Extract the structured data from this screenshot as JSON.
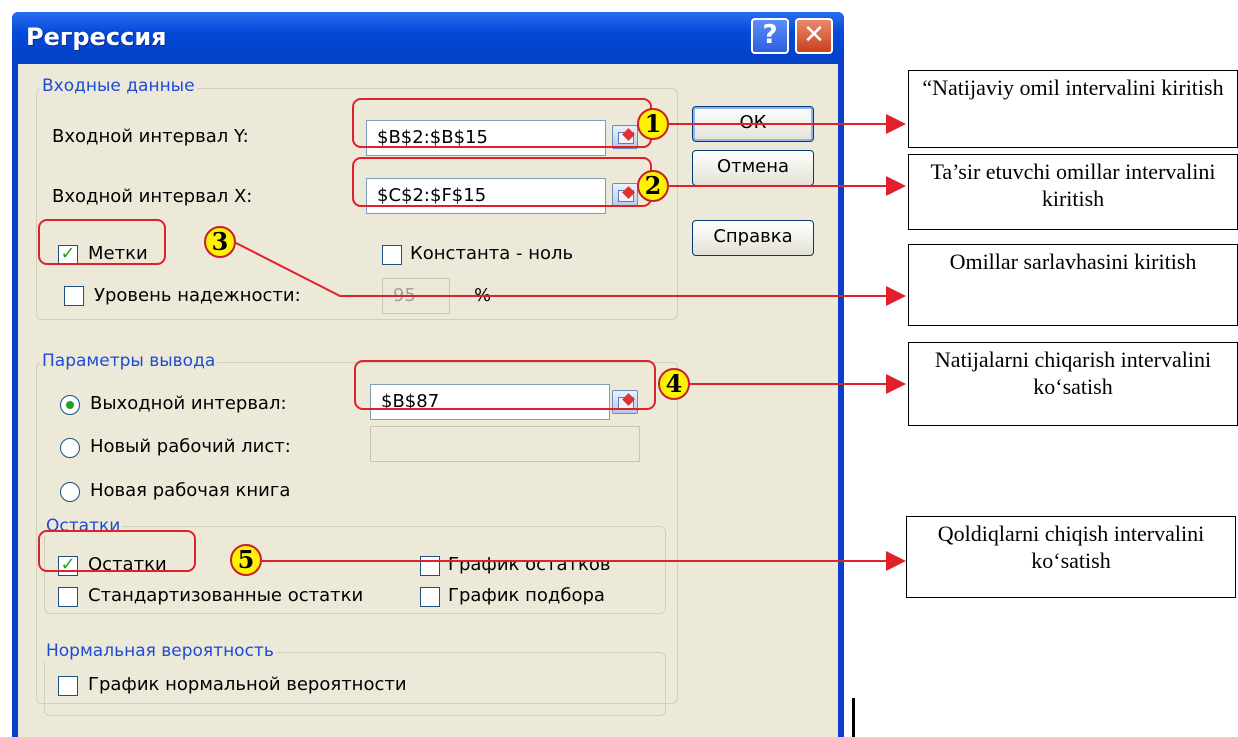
{
  "window": {
    "title": "Регрессия",
    "help": "?",
    "close": "✕"
  },
  "input": {
    "group": "Входные данные",
    "y_label": "Входной интервал Y:",
    "y_value": "$B$2:$B$15",
    "x_label": "Входной интервал X:",
    "x_value": "$C$2:$F$15",
    "labels": "Метки",
    "labels_checked": true,
    "const_zero": "Константа - ноль",
    "const_checked": false,
    "confidence": "Уровень надежности:",
    "confidence_checked": false,
    "confidence_value": "95",
    "percent": "%"
  },
  "output": {
    "group": "Параметры вывода",
    "range_label": "Выходной интервал:",
    "range_value": "$B$87",
    "new_sheet": "Новый рабочий лист:",
    "new_book": "Новая рабочая книга",
    "selected": "range"
  },
  "residuals": {
    "group": "Остатки",
    "residuals": "Остатки",
    "residuals_checked": true,
    "std_residuals": "Стандартизованные остатки",
    "residual_plot": "График остатков",
    "fit_plot": "График подбора"
  },
  "normal": {
    "group": "Нормальная вероятность",
    "plot": "График нормальной вероятности"
  },
  "buttons": {
    "ok": "ОК",
    "cancel": "Отмена",
    "help": "Справка"
  },
  "markers": [
    "1",
    "2",
    "3",
    "4",
    "5"
  ],
  "notes": [
    "“Natijaviy omil intervalini kiritish",
    "Ta’sir etuvchi omillar intervalini kiritish",
    "Omillar sarlavhasini kiritish",
    "Natijalarni chiqarish intervalini ko‘satish",
    "Qoldiqlarni chiqish intervalini ko‘satish"
  ],
  "colors": {
    "titlebar": "#0449d8",
    "dialog_bg": "#ece9d8",
    "annotation": "#e0202a",
    "marker": "#fff200"
  }
}
